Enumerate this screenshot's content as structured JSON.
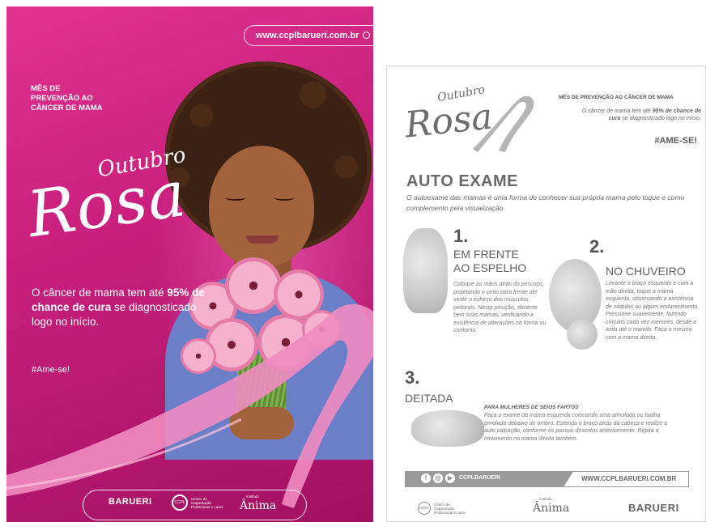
{
  "poster": {
    "url": "www.ccplbarueri.com.br",
    "month_lines": [
      "MÊS DE",
      "PREVENÇÃO AO",
      "CÂNCER DE MAMA"
    ],
    "outubro": "Outubro",
    "rosa": "Rosa",
    "cancer_pre": "O câncer de mama tem até ",
    "cancer_bold": "95% de chance de cura",
    "cancer_post": " se diagnosticado logo no início.",
    "hashtag": "#Ame-se!",
    "logos": {
      "barueri": "BARUERI",
      "ccpl_mark": "CCPL",
      "ccpl_text": "Centro de Capacitação Profissional e Lazer",
      "anima_small": "Instituto",
      "anima": "Ânima"
    },
    "colors": {
      "background": "#c81f7d",
      "ribbon": "#f08cc0",
      "text": "#ffffff"
    }
  },
  "flyer": {
    "outubro": "Outubro",
    "rosa": "Rosa",
    "month": "MÊS DE PREVENÇÃO AO CÂNCER DE MAMA",
    "cancer_pre": "O câncer de mama tem até ",
    "cancer_bold": "95% de chance de cura",
    "cancer_post": " se diagnosticado logo no início.",
    "hashtag": "#AME-SE!",
    "title": "AUTO EXAME",
    "intro": "O autoexame das mamas é uma forma de conhecer sua própria mama pelo toque e como complemento pela visualização",
    "steps": [
      {
        "num": "1.",
        "title_line1": "EM FRENTE",
        "title_line2": "AO ESPELHO",
        "text": "Coloque as mãos atrás do pescoço, projetando o peito para frente até sentir o esforço dos músculos peitorais. Nesta posição, observe bem suas mamas, verificando a existência de alterações na forma ou contorno."
      },
      {
        "num": "2.",
        "title_line1": "NO CHUVEIRO",
        "text": "Levante o braço esquerdo e com a mão direita, toque a mama esquerda, observando a existência de nódulos ou algum endurecimento. Pressione suavemente, fazendo círculos cada vez menores, desde a axila até o mamilo. Faça o mesmo com a mama direita."
      },
      {
        "num": "3.",
        "title_line1": "DEITADA"
      }
    ],
    "tip_heading": "PARA MULHERES DE SEIOS FARTOS",
    "tip": "Faça o exame da mama esquerda colocando uma almofada ou toalha enrolada debaixo do ombro. Estenda o braço atrás da cabeça e realize a auto palpação, conforme os passos descritos anteriormente. Repita o movimento na mama direita também.",
    "social_icons": [
      "f",
      "◎",
      "▶"
    ],
    "social_handle": "CCPLBARUERI",
    "site": "WWW.CCPLBARUERI.COM.BR",
    "logos": {
      "ccpl_mark": "CCPL",
      "ccpl_text": "Centro de Capacitação Profissional e Lazer",
      "anima_small": "Instituto",
      "anima": "Ânima",
      "barueri": "BARUERI"
    },
    "colors": {
      "gray": "#6a6a6a",
      "bar": "#9a9a9a"
    }
  }
}
